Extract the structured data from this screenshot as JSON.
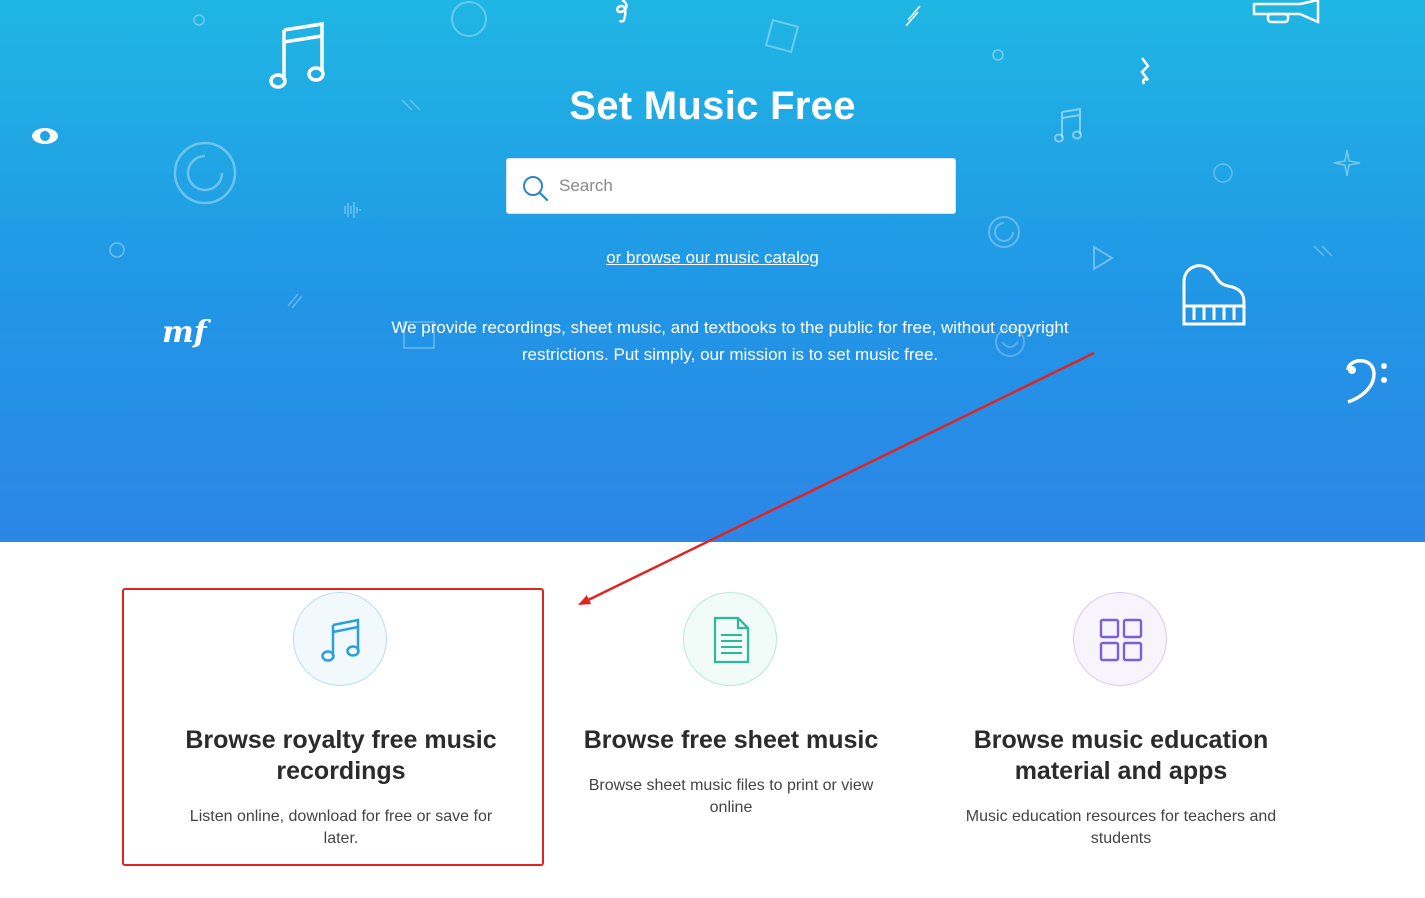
{
  "hero": {
    "title": "Set Music Free",
    "search": {
      "placeholder": "Search",
      "value": ""
    },
    "browse_link": "or browse our music catalog",
    "mission": "We provide recordings, sheet music, and textbooks to the public for free, without copyright restrictions. Put simply, our mission is to set music free.",
    "gradient_top": "#1fb6e3",
    "gradient_bottom": "#2c86e6"
  },
  "cards": [
    {
      "icon": "music-note-icon",
      "title": "Browse royalty free music recordings",
      "description": "Listen online, download for free or save for later.",
      "accent": "#2a9fdc"
    },
    {
      "icon": "document-icon",
      "title": "Browse free sheet music",
      "description": "Browse sheet music files to print or view online",
      "accent": "#2ab99a"
    },
    {
      "icon": "grid-apps-icon",
      "title": "Browse music education material and apps",
      "description": "Music education resources for teachers and students",
      "accent": "#7b5fd6"
    }
  ],
  "annotation": {
    "color": "#e02424"
  }
}
